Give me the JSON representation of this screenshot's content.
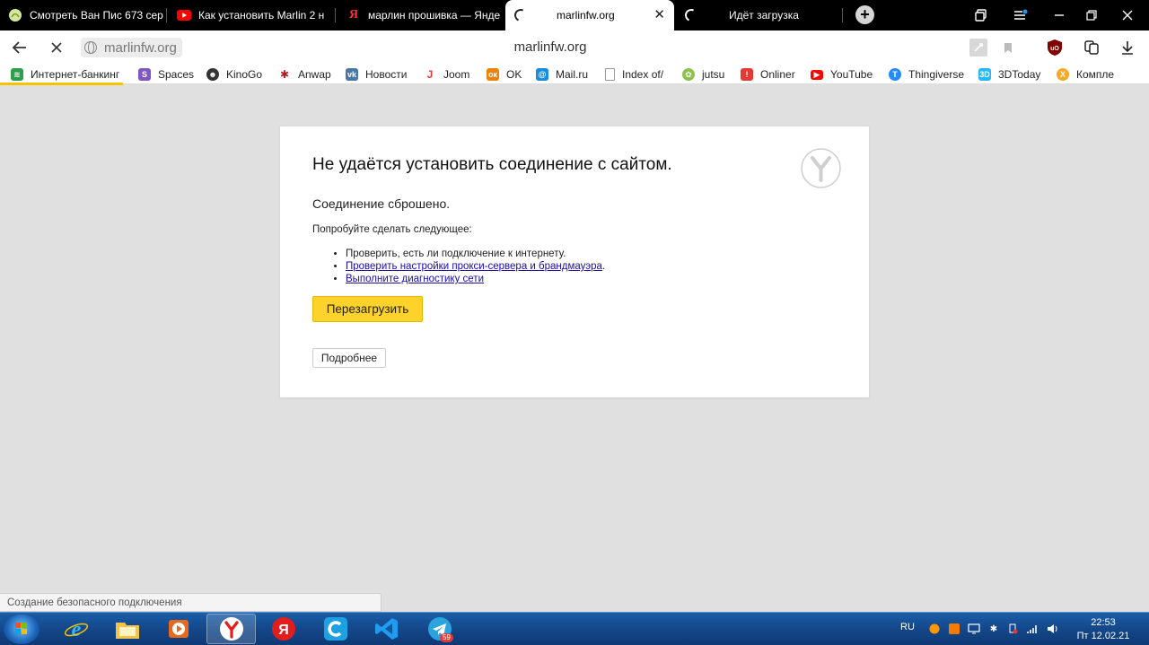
{
  "tabs": [
    {
      "title": "Смотреть Ван Пис 673 сер",
      "icon": "anime-favicon-icon",
      "active": false
    },
    {
      "title": "Как установить Marlin 2 н",
      "icon": "youtube-icon",
      "active": false
    },
    {
      "title": "марлин прошивка — Янде",
      "icon": "yandex-icon",
      "active": false
    },
    {
      "title": "marlinfw.org",
      "icon": "loading-spinner-icon",
      "active": true
    },
    {
      "title": "Идёт загрузка",
      "icon": "loading-spinner-icon",
      "active": false
    }
  ],
  "address_bar": {
    "url_pill": "marlinfw.org",
    "page_host": "marlinfw.org"
  },
  "bookmarks": [
    {
      "label": "Интернет-банкинг",
      "icon": "bank-icon",
      "color": "#2e9e4a"
    },
    {
      "label": "Spaces",
      "icon": "spaces-icon",
      "color": "#7e57c2"
    },
    {
      "label": "KinoGo",
      "icon": "kinogo-icon",
      "color": "#333333"
    },
    {
      "label": "Anwap",
      "icon": "bug-icon",
      "color": "#b71c1c"
    },
    {
      "label": "Новости",
      "icon": "vk-icon",
      "color": "#4a76a8"
    },
    {
      "label": "Joom",
      "icon": "joom-icon",
      "color": "#e53935"
    },
    {
      "label": "OK",
      "icon": "odnoklassniki-icon",
      "color": "#ee8208"
    },
    {
      "label": "Mail.ru",
      "icon": "mailru-icon",
      "color": "#168de2"
    },
    {
      "label": "Index of/",
      "icon": "document-icon",
      "color": "#9e9e9e"
    },
    {
      "label": "jutsu",
      "icon": "jutsu-icon",
      "color": "#8bc34a"
    },
    {
      "label": "Onliner",
      "icon": "onliner-icon",
      "color": "#e53935"
    },
    {
      "label": "YouTube",
      "icon": "youtube-icon",
      "color": "#ff0000"
    },
    {
      "label": "Thingiverse",
      "icon": "thingiverse-icon",
      "color": "#248bfb"
    },
    {
      "label": "3DToday",
      "icon": "3dtoday-icon",
      "color": "#29b6f6"
    },
    {
      "label": "Компле",
      "icon": "komple-icon",
      "color": "#f9a825"
    }
  ],
  "error": {
    "title": "Не удаётся установить соединение с сайтом.",
    "subtitle": "Соединение сброшено.",
    "try_label": "Попробуйте сделать следующее:",
    "suggestions": [
      {
        "text": "Проверить, есть ли подключение к интернету.",
        "link": false
      },
      {
        "text": "Проверить настройки прокси-сервера и брандмауэра",
        "link": true,
        "suffix": "."
      },
      {
        "text": "Выполните диагностику сети",
        "link": true,
        "suffix": ""
      }
    ],
    "reload_label": "Перезагрузить",
    "details_label": "Подробнее"
  },
  "status_text": "Создание безопасного подключения",
  "taskbar": {
    "apps": [
      "internet-explorer-icon",
      "file-explorer-icon",
      "media-player-icon",
      "yandex-browser-icon",
      "yandex-icon",
      "ccleaner-icon",
      "vscode-icon",
      "telegram-icon"
    ],
    "telegram_badge": "59",
    "lang": "RU",
    "time": "22:53",
    "date": "Пт 12.02.21"
  },
  "colors": {
    "accent_yellow": "#fdd22b",
    "link": "#1a0dab",
    "page_bg": "#e0e0e0"
  }
}
